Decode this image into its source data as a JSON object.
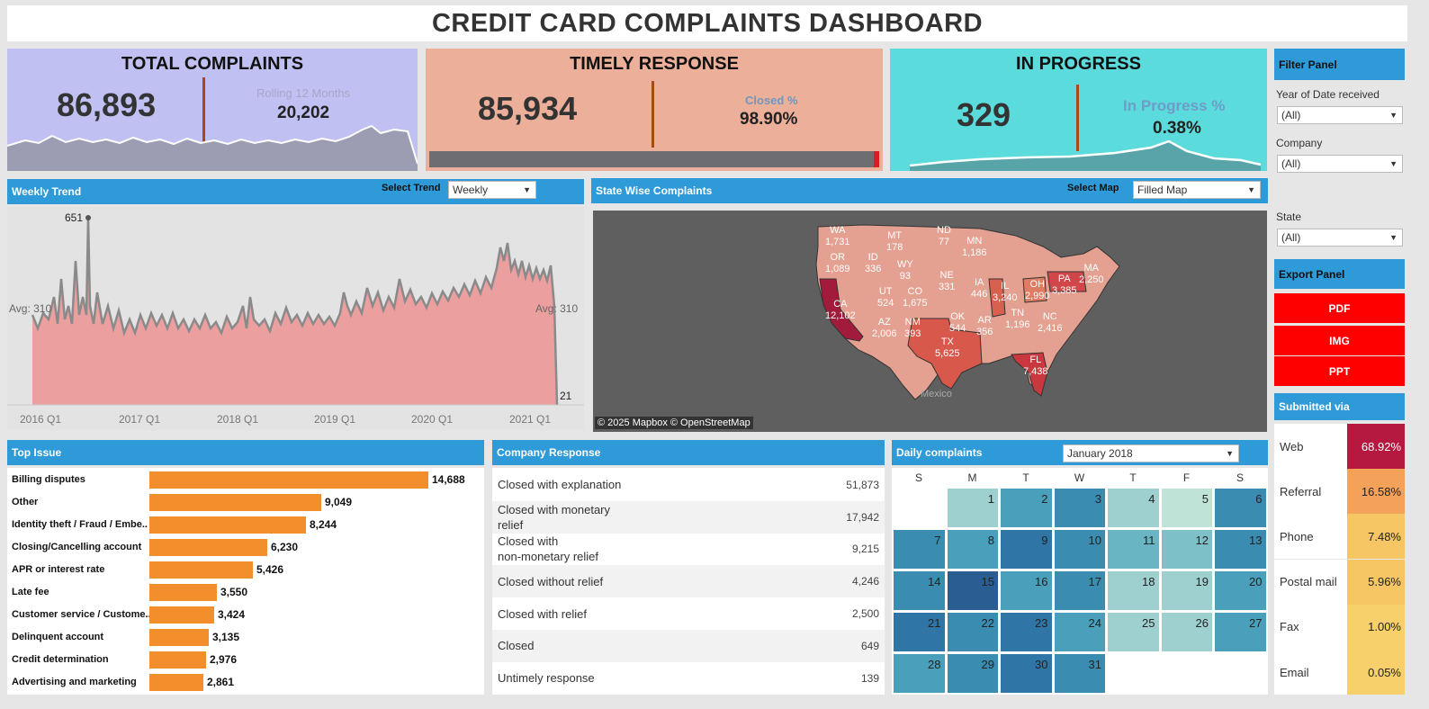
{
  "dashboard_title": "CREDIT CARD COMPLAINTS DASHBOARD",
  "kpis": {
    "total": {
      "title": "TOTAL COMPLAINTS",
      "value": "86,893",
      "sub_label": "Rolling 12 Months",
      "sub_value": "20,202"
    },
    "timely": {
      "title": "TIMELY RESPONSE",
      "value": "85,934",
      "sub_label": "Closed %",
      "sub_value": "98.90%",
      "closed_fraction": 0.989
    },
    "in_progress": {
      "title": "IN PROGRESS",
      "value": "329",
      "sub_label": "In Progress %",
      "sub_value": "0.38%"
    }
  },
  "weekly_trend": {
    "panel_title": "Weekly Trend",
    "select_label": "Select Trend",
    "select_value": "Weekly",
    "peak_label": "651",
    "avg_left": "Avg: 310",
    "avg_right": "Avg: 310",
    "last_label": "21",
    "x_ticks": [
      "2016 Q1",
      "2017 Q1",
      "2018 Q1",
      "2019 Q1",
      "2020 Q1",
      "2021 Q1"
    ]
  },
  "map": {
    "panel_title": "State Wise Complaints",
    "select_label": "Select Map",
    "select_value": "Filled Map",
    "country_label": "Mexico",
    "attribution": "© 2025 Mapbox © OpenStreetMap",
    "states": [
      {
        "code": "WA",
        "value": "1,731"
      },
      {
        "code": "OR",
        "value": "1,089"
      },
      {
        "code": "ID",
        "value": "336"
      },
      {
        "code": "MT",
        "value": "178"
      },
      {
        "code": "ND",
        "value": "77"
      },
      {
        "code": "MN",
        "value": "1,186"
      },
      {
        "code": "WY",
        "value": "93"
      },
      {
        "code": "NE",
        "value": "331"
      },
      {
        "code": "IA",
        "value": "446"
      },
      {
        "code": "UT",
        "value": "524"
      },
      {
        "code": "CO",
        "value": "1,675"
      },
      {
        "code": "IL",
        "value": "3,240"
      },
      {
        "code": "OH",
        "value": "2,990"
      },
      {
        "code": "PA",
        "value": "3,385"
      },
      {
        "code": "MA",
        "value": "2,250"
      },
      {
        "code": "CA",
        "value": "12,102"
      },
      {
        "code": "AZ",
        "value": "2,006"
      },
      {
        "code": "NM",
        "value": "393"
      },
      {
        "code": "OK",
        "value": "544"
      },
      {
        "code": "AR",
        "value": "356"
      },
      {
        "code": "TN",
        "value": "1,196"
      },
      {
        "code": "NC",
        "value": "2,416"
      },
      {
        "code": "TX",
        "value": "5,625"
      },
      {
        "code": "FL",
        "value": "7,438"
      }
    ]
  },
  "filters": {
    "panel_title": "Filter Panel",
    "year_label": "Year of Date received",
    "year_value": "(All)",
    "company_label": "Company",
    "company_value": "(All)",
    "state_label": "State",
    "state_value": "(All)"
  },
  "export": {
    "panel_title": "Export Panel",
    "buttons": [
      "PDF",
      "IMG",
      "PPT"
    ]
  },
  "top_issue": {
    "panel_title": "Top Issue",
    "rows": [
      {
        "label": "Billing disputes",
        "value": "14,688",
        "num": 14688
      },
      {
        "label": "Other",
        "value": "9,049",
        "num": 9049
      },
      {
        "label": "Identity theft / Fraud / Embe..",
        "value": "8,244",
        "num": 8244
      },
      {
        "label": "Closing/Cancelling account",
        "value": "6,230",
        "num": 6230
      },
      {
        "label": "APR or interest rate",
        "value": "5,426",
        "num": 5426
      },
      {
        "label": "Late fee",
        "value": "3,550",
        "num": 3550
      },
      {
        "label": "Customer service / Custome..",
        "value": "3,424",
        "num": 3424
      },
      {
        "label": "Delinquent account",
        "value": "3,135",
        "num": 3135
      },
      {
        "label": "Credit determination",
        "value": "2,976",
        "num": 2976
      },
      {
        "label": "Advertising and marketing",
        "value": "2,861",
        "num": 2861
      }
    ]
  },
  "company_response": {
    "panel_title": "Company Response",
    "rows": [
      {
        "label": "Closed with explanation",
        "value": "51,873"
      },
      {
        "label": "Closed with monetary\nrelief",
        "value": "17,942"
      },
      {
        "label": "Closed with\nnon-monetary relief",
        "value": "9,215"
      },
      {
        "label": "Closed without relief",
        "value": "4,246"
      },
      {
        "label": "Closed with relief",
        "value": "2,500"
      },
      {
        "label": "Closed",
        "value": "649"
      },
      {
        "label": "Untimely response",
        "value": "139"
      }
    ]
  },
  "daily": {
    "panel_title": "Daily complaints",
    "select_value": "January 2018",
    "weekdays": [
      "S",
      "M",
      "T",
      "W",
      "T",
      "F",
      "S"
    ],
    "days": [
      {
        "d": "1",
        "c": "#9fd0d0"
      },
      {
        "d": "2",
        "c": "#4a9fbb"
      },
      {
        "d": "3",
        "c": "#3a8cb0"
      },
      {
        "d": "4",
        "c": "#9fd0d0"
      },
      {
        "d": "5",
        "c": "#bfe3d6"
      },
      {
        "d": "6",
        "c": "#3a8cb0"
      },
      {
        "d": "7",
        "c": "#3a8cb0"
      },
      {
        "d": "8",
        "c": "#4a9fbb"
      },
      {
        "d": "9",
        "c": "#2f76a6"
      },
      {
        "d": "10",
        "c": "#3a8cb0"
      },
      {
        "d": "11",
        "c": "#6ab5c4"
      },
      {
        "d": "12",
        "c": "#7dc0c8"
      },
      {
        "d": "13",
        "c": "#3a8cb0"
      },
      {
        "d": "14",
        "c": "#3a8cb0"
      },
      {
        "d": "15",
        "c": "#2a5e93"
      },
      {
        "d": "16",
        "c": "#4a9fbb"
      },
      {
        "d": "17",
        "c": "#3a8cb0"
      },
      {
        "d": "18",
        "c": "#9fd0d0"
      },
      {
        "d": "19",
        "c": "#9fd0d0"
      },
      {
        "d": "20",
        "c": "#4a9fbb"
      },
      {
        "d": "21",
        "c": "#2f76a6"
      },
      {
        "d": "22",
        "c": "#3a8cb0"
      },
      {
        "d": "23",
        "c": "#2f76a6"
      },
      {
        "d": "24",
        "c": "#4a9fbb"
      },
      {
        "d": "25",
        "c": "#9fd0d0"
      },
      {
        "d": "26",
        "c": "#9fd0d0"
      },
      {
        "d": "27",
        "c": "#4a9fbb"
      },
      {
        "d": "28",
        "c": "#4a9fbb"
      },
      {
        "d": "29",
        "c": "#3a8cb0"
      },
      {
        "d": "30",
        "c": "#2f76a6"
      },
      {
        "d": "31",
        "c": "#3a8cb0"
      }
    ]
  },
  "submitted": {
    "panel_title": "Submitted via",
    "rows": [
      {
        "label": "Web",
        "value": "68.92%",
        "color": "#b5193f"
      },
      {
        "label": "Referral",
        "value": "16.58%",
        "color": "#f4a259"
      },
      {
        "label": "Phone",
        "value": "7.48%",
        "color": "#f6c665"
      },
      {
        "label": "Postal mail",
        "value": "5.96%",
        "color": "#f6c665"
      },
      {
        "label": "Fax",
        "value": "1.00%",
        "color": "#f7cf6b"
      },
      {
        "label": "Email",
        "value": "0.05%",
        "color": "#f7cf6b"
      }
    ]
  },
  "colors": {
    "panel_header": "#2e9ad8",
    "kpi_total": "#c0c0f2",
    "kpi_timely": "#ecb09a",
    "kpi_progress": "#5bdbdc",
    "bar": "#f28e2b",
    "export": "#ff0000"
  }
}
